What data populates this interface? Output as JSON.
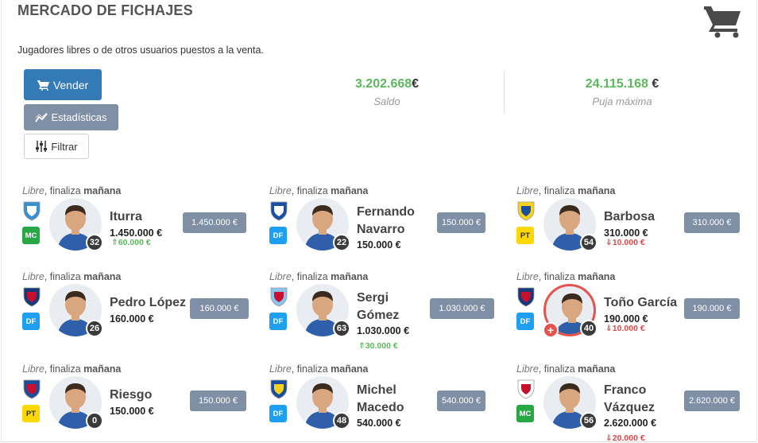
{
  "header": {
    "title": "MERCADO DE FICHAJES",
    "subtitle": "Jugadores libres o de otros usuarios puestos a la venta."
  },
  "actions": {
    "sell_label": "Vender",
    "stats_label": "Estadísticas",
    "filter_label": "Filtrar"
  },
  "stats": {
    "balance_value": "3.202.668",
    "balance_currency": "€",
    "balance_label": "Saldo",
    "maxbid_value": "24.115.168",
    "maxbid_currency": "€",
    "maxbid_label": "Puja máxima"
  },
  "colors": {
    "primary": "#337ab7",
    "secondary": "#7f8fa6",
    "positive": "#5cb85c",
    "negative": "#e04848",
    "pos_mc": "#28a745",
    "pos_df": "#1e9ff2",
    "pos_pt": "#ffd800"
  },
  "players": [
    {
      "status_type": "Libre",
      "status_sep": ", finaliza ",
      "status_when": "mañana",
      "crest": "malaga-crest-icon",
      "position": "MC",
      "name_1": "Iturra",
      "name_2": "",
      "value": "1.450.000 €",
      "trend": "⇑60.000 €",
      "trend_dir": "up",
      "number": "32",
      "price": "1.450.000 €"
    },
    {
      "status_type": "Libre",
      "status_sep": ", finaliza ",
      "status_when": "mañana",
      "crest": "deportivo-crest-icon",
      "position": "DF",
      "name_1": "Fernando",
      "name_2": "Navarro",
      "value": "150.000 €",
      "trend": "",
      "trend_dir": "",
      "number": "22",
      "price": "150.000 €"
    },
    {
      "status_type": "Libre",
      "status_sep": ", finaliza ",
      "status_when": "mañana",
      "crest": "villarreal-crest-icon",
      "position": "PT",
      "name_1": "Barbosa",
      "name_2": "",
      "value": "310.000 €",
      "trend": "⇓10.000 €",
      "trend_dir": "down",
      "number": "54",
      "price": "310.000 €"
    },
    {
      "status_type": "Libre",
      "status_sep": ", finaliza ",
      "status_when": "mañana",
      "crest": "levante-crest-icon",
      "position": "DF",
      "name_1": "Pedro López",
      "name_2": "",
      "value": "160.000 €",
      "trend": "",
      "trend_dir": "",
      "number": "26",
      "price": "160.000 €"
    },
    {
      "status_type": "Libre",
      "status_sep": ", finaliza ",
      "status_when": "mañana",
      "crest": "celta-crest-icon",
      "position": "DF",
      "name_1": "Sergi",
      "name_2": "Gómez",
      "value": "1.030.000 €",
      "trend": "⇑30.000 €",
      "trend_dir": "up",
      "number": "63",
      "price": "1.030.000 €"
    },
    {
      "status_type": "Libre",
      "status_sep": ", finaliza ",
      "status_when": "mañana",
      "crest": "levante-crest-icon",
      "position": "DF",
      "name_1": "Toño García",
      "name_2": "",
      "value": "190.000 €",
      "trend": "⇓10.000 €",
      "trend_dir": "down",
      "number": "40",
      "price": "190.000 €",
      "injured": true
    },
    {
      "status_type": "Libre",
      "status_sep": ", finaliza ",
      "status_when": "mañana",
      "crest": "eibar-crest-icon",
      "position": "PT",
      "name_1": "Riesgo",
      "name_2": "",
      "value": "150.000 €",
      "trend": "",
      "trend_dir": "",
      "number": "0",
      "price": "150.000 €"
    },
    {
      "status_type": "Libre",
      "status_sep": ", finaliza ",
      "status_when": "mañana",
      "crest": "laspalmas-crest-icon",
      "position": "DF",
      "name_1": "Michel",
      "name_2": "Macedo",
      "value": "540.000 €",
      "trend": "",
      "trend_dir": "",
      "number": "48",
      "price": "540.000 €"
    },
    {
      "status_type": "Libre",
      "status_sep": ", finaliza ",
      "status_when": "mañana",
      "crest": "sevilla-crest-icon",
      "position": "MC",
      "name_1": "Franco",
      "name_2": "Vázquez",
      "value": "2.620.000 €",
      "trend": "⇓20.000 €",
      "trend_dir": "down",
      "number": "56",
      "price": "2.620.000 €"
    }
  ]
}
